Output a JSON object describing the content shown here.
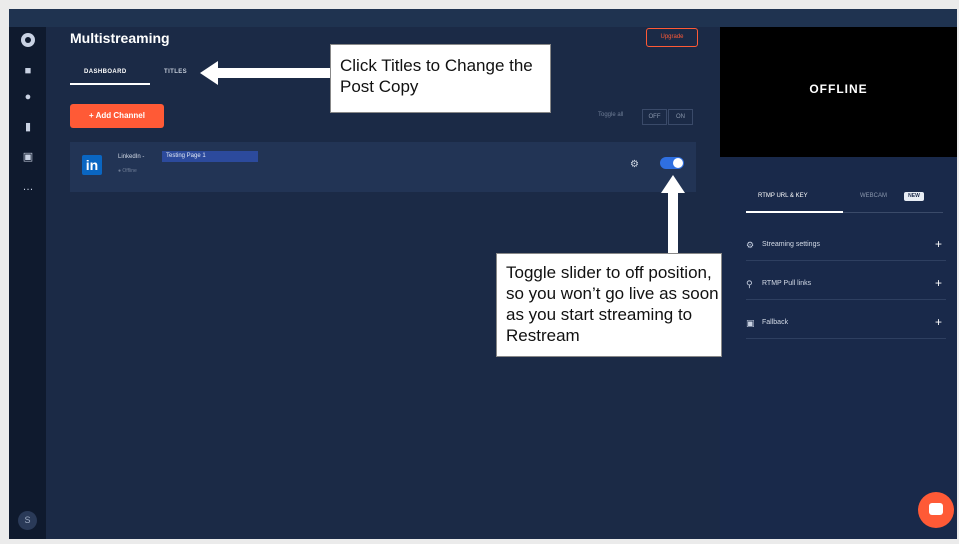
{
  "app": {
    "title": "Multistreaming",
    "upgrade": "Upgrade"
  },
  "tabs": {
    "dashboard": "DASHBOARD",
    "titles": "TITLES"
  },
  "actions": {
    "add_channel": "+ Add Channel",
    "toggle_all": "Toggle all",
    "off": "OFF",
    "on": "ON"
  },
  "channel": {
    "name": "LinkedIn -",
    "page": "Testing Page 1",
    "status": "● Offline",
    "enabled": true
  },
  "preview": {
    "status": "OFFLINE"
  },
  "right_tabs": {
    "rtmp": "RTMP URL & KEY",
    "webcam": "WEBCAM",
    "new_badge": "NEW"
  },
  "settings": [
    {
      "label": "Streaming settings",
      "icon": "gear-icon"
    },
    {
      "label": "RTMP Pull links",
      "icon": "link-icon"
    },
    {
      "label": "Fallback",
      "icon": "video-icon"
    }
  ],
  "annotations": {
    "titles_callout": "Click Titles to Change the Post Copy",
    "toggle_callout": "Toggle slider to off position, so you won’t go live as soon as you start streaming to Restream"
  },
  "user": {
    "initial": "S"
  },
  "colors": {
    "accent": "#ff5a36",
    "linkedin": "#0a66c2",
    "toggle": "#2f6fe0"
  }
}
